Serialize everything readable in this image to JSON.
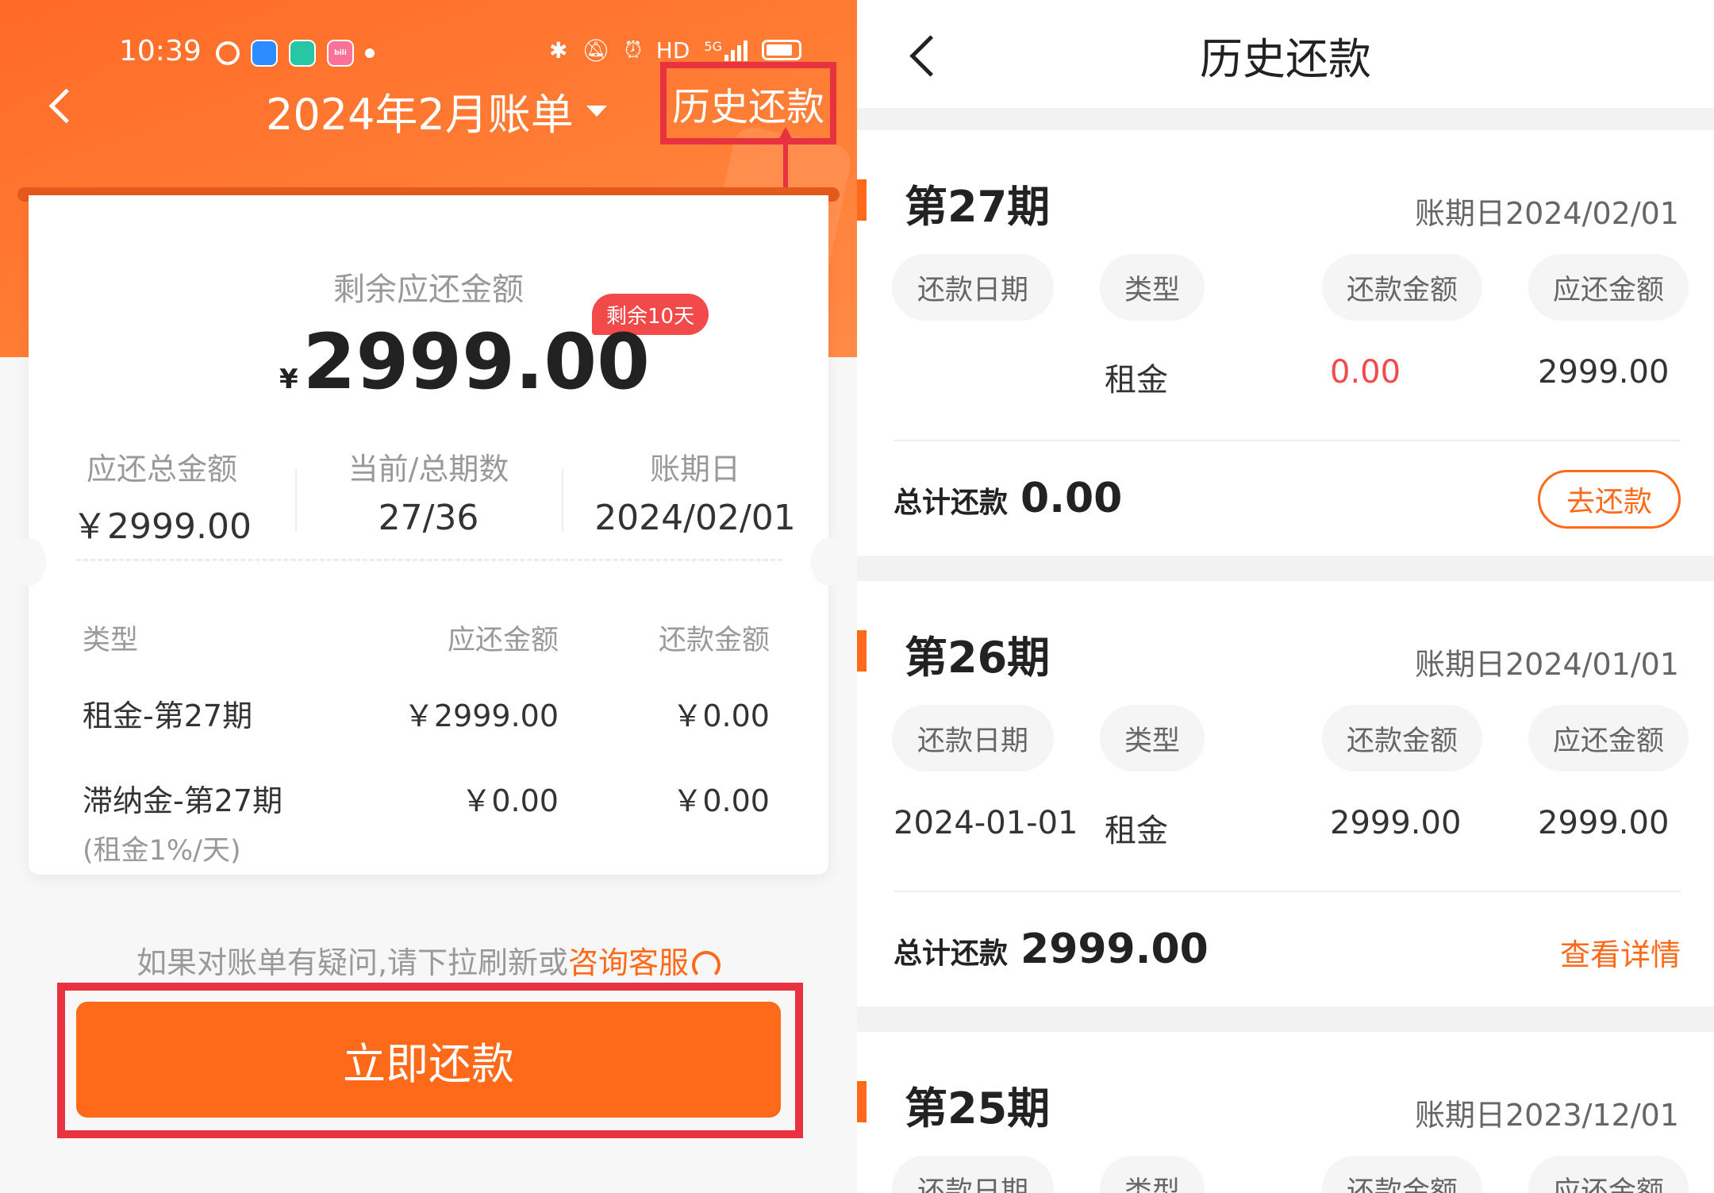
{
  "colors": {
    "brand_orange": "#ff6a1a",
    "highlight_red": "#e9323f",
    "badge_red": "#f24a4a"
  },
  "left": {
    "status_bar": {
      "time": "10:39",
      "hd": "HD",
      "network": "5G"
    },
    "nav": {
      "title": "2024年2月账单",
      "history_link": "历史还款"
    },
    "summary": {
      "remaining_label": "剩余应还金额",
      "remaining_badge": "剩余10天",
      "currency_symbol": "¥",
      "remaining_amount": "2999.00",
      "stats": [
        {
          "label": "应还总金额",
          "value": "￥2999.00"
        },
        {
          "label": "当前/总期数",
          "value": "27/36"
        },
        {
          "label": "账期日",
          "value": "2024/02/01"
        }
      ]
    },
    "details": {
      "headers": [
        "类型",
        "应还金额",
        "还款金额"
      ],
      "rows": [
        {
          "type": "租金-第27期",
          "due": "￥2999.00",
          "paid": "￥0.00",
          "note": ""
        },
        {
          "type": "滞纳金-第27期",
          "due": "￥0.00",
          "paid": "￥0.00",
          "note": "(租金1%/天)"
        }
      ]
    },
    "hint": {
      "text": "如果对账单有疑问,请下拉刷新或",
      "link": "咨询客服"
    },
    "pay_button": "立即还款"
  },
  "right": {
    "title": "历史还款",
    "column_headers": [
      "还款日期",
      "类型",
      "还款金额",
      "应还金额"
    ],
    "total_label": "总计还款",
    "periods": [
      {
        "title": "第27期",
        "due_date": "账期日2024/02/01",
        "pay_date": "",
        "type": "租金",
        "paid": "0.00",
        "due": "2999.00",
        "total": "0.00",
        "action": "去还款"
      },
      {
        "title": "第26期",
        "due_date": "账期日2024/01/01",
        "pay_date": "2024-01-01",
        "type": "租金",
        "paid": "2999.00",
        "due": "2999.00",
        "total": "2999.00",
        "action": "查看详情"
      },
      {
        "title": "第25期",
        "due_date": "账期日2023/12/01"
      }
    ]
  }
}
